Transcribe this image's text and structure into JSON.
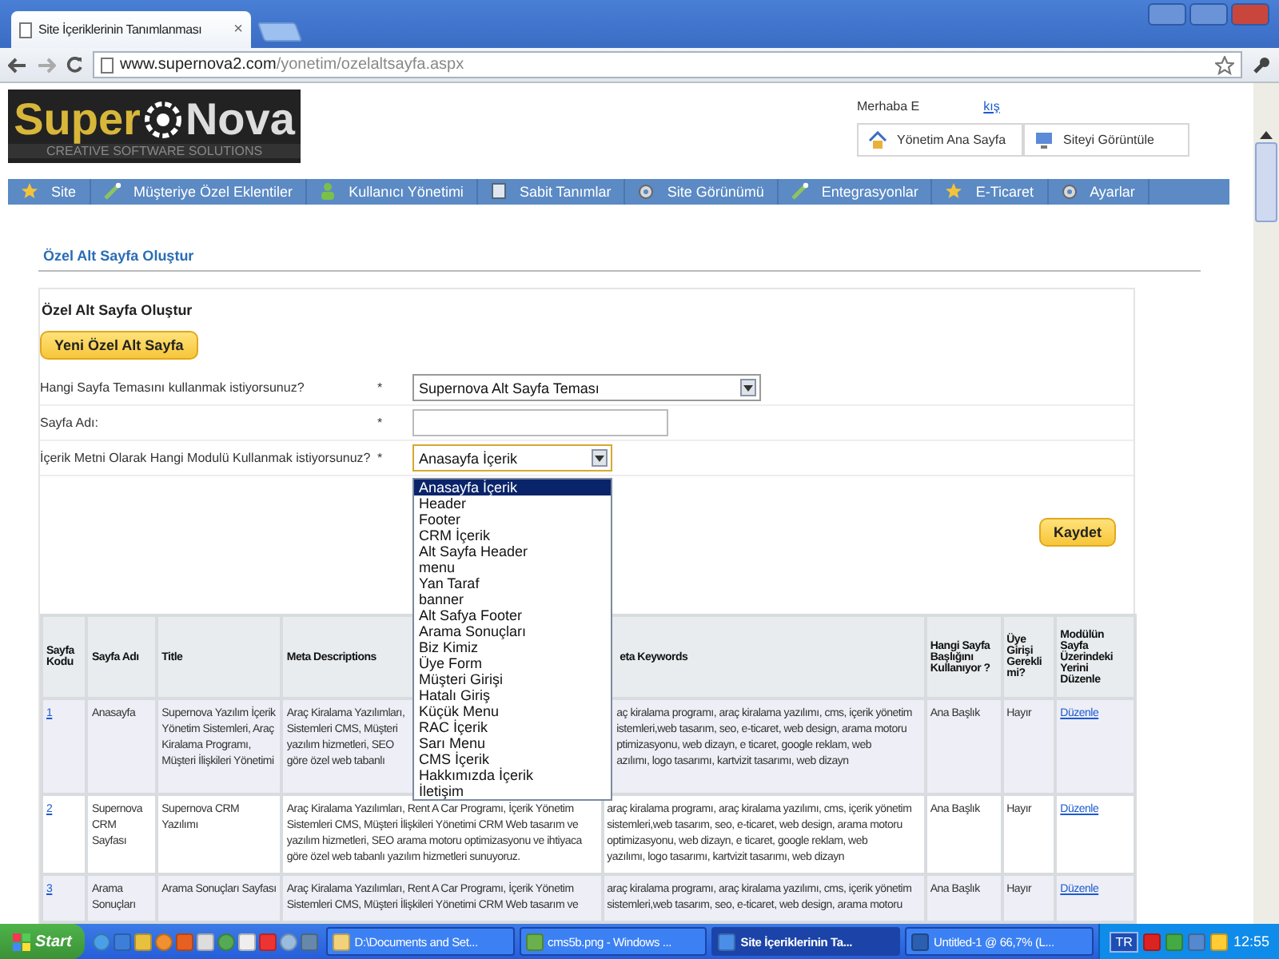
{
  "browser": {
    "tab_title": "Site İçeriklerinin Tanımlanması",
    "tab_close": "×",
    "url_host": "www.supernova2.com",
    "url_path": "/yonetim/ozelaltsayfa.aspx"
  },
  "logo": {
    "left": "Super",
    "right": "Nova",
    "tagline": "CREATIVE SOFTWARE SOLUTIONS"
  },
  "user": {
    "greeting": "Merhaba E",
    "logout": "kış"
  },
  "top_buttons": [
    "Yönetim Ana Sayfa",
    "Siteyi Görüntüle"
  ],
  "nav": [
    {
      "label": "Site"
    },
    {
      "label": "Müşteriye Özel Eklentiler"
    },
    {
      "label": "Kullanıcı Yönetimi"
    },
    {
      "label": "Sabit Tanımlar"
    },
    {
      "label": "Site Görünümü"
    },
    {
      "label": "Entegrasyonlar"
    },
    {
      "label": "E-Ticaret"
    },
    {
      "label": "Ayarlar"
    }
  ],
  "page_title": "Özel Alt Sayfa Oluştur",
  "form": {
    "title": "Özel Alt Sayfa Oluştur",
    "new_button": "Yeni Özel Alt Sayfa",
    "save_button": "Kaydet",
    "fields": [
      {
        "kind": "select",
        "label": "Hangi Sayfa Temasını kullanmak istiyorsunuz?",
        "required": "*",
        "value": "Supernova Alt Sayfa Teması"
      },
      {
        "kind": "text",
        "label": "Sayfa Adı:",
        "required": "*"
      },
      {
        "kind": "select",
        "label": "İçerik Metni Olarak Hangi Modulü Kullanmak istiyorsunuz?",
        "required": "*",
        "value": "Anasayfa İçerik",
        "expanded": true
      }
    ],
    "options": [
      {
        "label": "Anasayfa İçerik",
        "selected": true
      },
      {
        "label": "Header",
        "selected": false
      },
      {
        "label": "Footer",
        "selected": false
      },
      {
        "label": "CRM İçerik",
        "selected": false
      },
      {
        "label": "Alt Sayfa Header",
        "selected": false
      },
      {
        "label": "menu",
        "selected": false
      },
      {
        "label": "Yan Taraf",
        "selected": false
      },
      {
        "label": "banner",
        "selected": false
      },
      {
        "label": "Alt Safya Footer",
        "selected": false
      },
      {
        "label": "Arama Sonuçları",
        "selected": false
      },
      {
        "label": "Biz Kimiz",
        "selected": false
      },
      {
        "label": "Üye Form",
        "selected": false
      },
      {
        "label": "Müşteri Girişi",
        "selected": false
      },
      {
        "label": "Hatalı Giriş",
        "selected": false
      },
      {
        "label": "Küçük Menu",
        "selected": false
      },
      {
        "label": "RAC İçerik",
        "selected": false
      },
      {
        "label": "Sarı Menu",
        "selected": false
      },
      {
        "label": "CMS İçerik",
        "selected": false
      },
      {
        "label": "Hakkımızda İçerik",
        "selected": false
      },
      {
        "label": "İletişim",
        "selected": false
      }
    ]
  },
  "table": {
    "columns": [
      "Sayfa Kodu",
      "Sayfa Adı",
      "Title",
      "Meta Descriptions",
      "eta Keywords",
      "Hangi Sayfa Başlığını Kullanıyor ?",
      "Üye Girişi Gerekli mi?",
      "Modülün Sayfa Üzerindeki Yerini Düzenle"
    ],
    "rows": [
      {
        "code": "1",
        "name": "Anasayfa",
        "title": "Supernova Yazılım İçerik Yönetim Sistemleri, Araç Kiralama Programı, Müşteri İlişkileri Yönetimi",
        "meta_descriptions": "Araç Kiralama Yazılımları,\nSistemleri CMS, Müşteri\nyazılım hizmetleri, SEO\ngöre özel web tabanlı",
        "meta_keywords": "aç kiralama programı, araç kiralama yazılımı, cms, içerik yönetim\nistemleri,web tasarım, seo, e-ticaret, web design, arama motoru\nptimizasyonu, web dizayn, e ticaret, google reklam, web\nazılımı, logo tasarımı, kartvizit tasarımı, web dizayn",
        "heading": "Ana Başlık",
        "login": "Hayır",
        "edit": "Düzenle"
      },
      {
        "code": "2",
        "name": "Supernova CRM Sayfası",
        "title": "Supernova CRM Yazılımı",
        "meta_descriptions": "Araç Kiralama Yazılımları, Rent A Car Programı, İçerik Yönetim\nSistemleri CMS, Müşteri İlişkileri Yönetimi CRM Web tasarım ve\nyazılım hizmetleri, SEO arama motoru optimizasyonu ve ihtiyaca\ngöre özel web tabanlı yazılım hizmetleri sunuyoruz.",
        "meta_keywords": "araç kiralama programı, araç kiralama yazılımı, cms, içerik yönetim\nsistemleri,web tasarım, seo, e-ticaret, web design, arama motoru\noptimizasyonu, web dizayn, e ticaret, google reklam, web\nyazılımı, logo tasarımı, kartvizit tasarımı, web dizayn",
        "heading": "Ana Başlık",
        "login": "Hayır",
        "edit": "Düzenle"
      },
      {
        "code": "3",
        "name": "Arama Sonuçları",
        "title": "Arama Sonuçları Sayfası",
        "meta_descriptions": "Araç Kiralama Yazılımları, Rent A Car Programı, İçerik Yönetim\nSistemleri CMS, Müşteri İlişkileri Yönetimi CRM Web tasarım ve",
        "meta_keywords": "araç kiralama programı, araç kiralama yazılımı, cms, içerik yönetim\nsistemleri,web tasarım, seo, e-ticaret, web design, arama motoru",
        "heading": "Ana Başlık",
        "login": "Hayır",
        "edit": "Düzenle"
      }
    ]
  },
  "taskbar": {
    "start": "Start",
    "tasks": [
      {
        "label": "D:\\Documents and Set...",
        "selected": false
      },
      {
        "label": "cms5b.png - Windows ...",
        "selected": false
      },
      {
        "label": "Site İçeriklerinin Ta...",
        "selected": true
      },
      {
        "label": "Untitled-1 @ 66,7% (L...",
        "selected": false
      }
    ],
    "language": "TR",
    "clock": "12:55"
  }
}
